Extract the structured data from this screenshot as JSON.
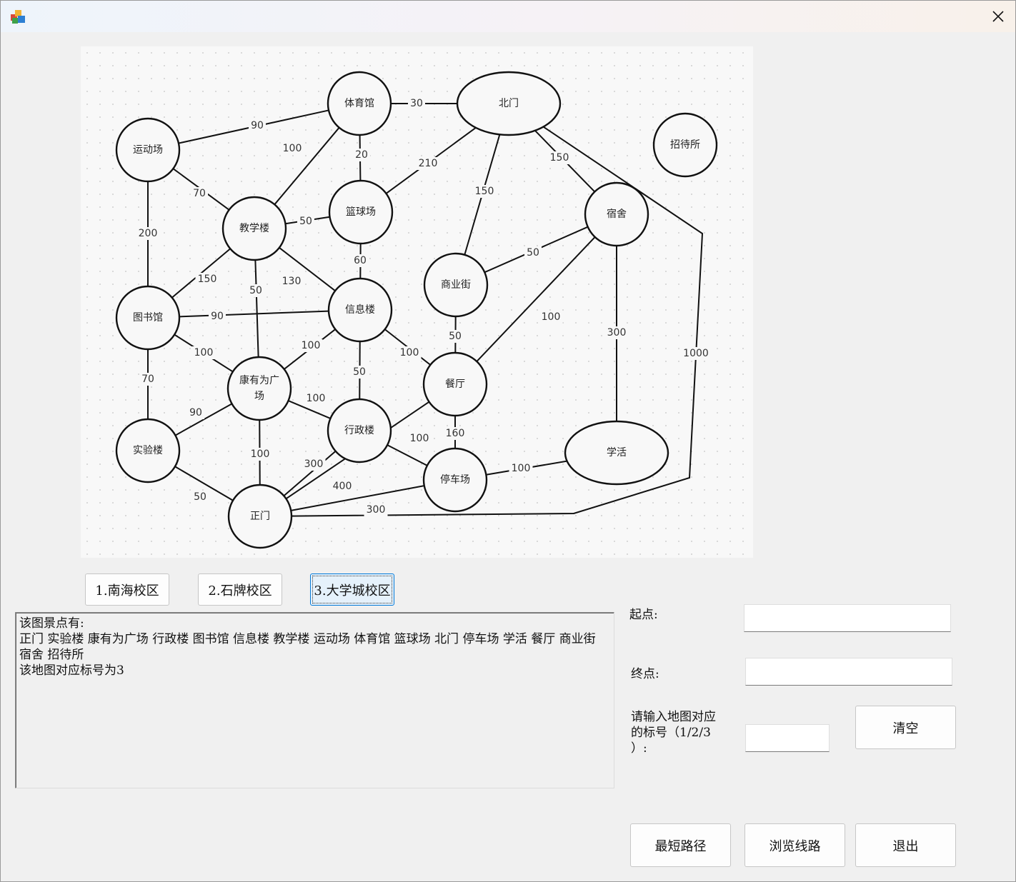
{
  "window": {
    "title": ""
  },
  "map": {
    "nodes": [
      {
        "id": "yundongchang",
        "label": "运动场",
        "shape": "circle"
      },
      {
        "id": "tiyuguan",
        "label": "体育馆",
        "shape": "circle"
      },
      {
        "id": "beimen",
        "label": "北门",
        "shape": "ellipse"
      },
      {
        "id": "zhaodaisuo",
        "label": "招待所",
        "shape": "circle"
      },
      {
        "id": "jiaoxuelou",
        "label": "教学楼",
        "shape": "circle"
      },
      {
        "id": "lanqiuchang",
        "label": "篮球场",
        "shape": "circle"
      },
      {
        "id": "sushe",
        "label": "宿舍",
        "shape": "circle"
      },
      {
        "id": "tushuguan",
        "label": "图书馆",
        "shape": "circle"
      },
      {
        "id": "xinxilou",
        "label": "信息楼",
        "shape": "circle"
      },
      {
        "id": "shangyejie",
        "label": "商业街",
        "shape": "circle"
      },
      {
        "id": "kangyouwei",
        "label": "康有为广\n场",
        "shape": "circle"
      },
      {
        "id": "canting",
        "label": "餐厅",
        "shape": "circle"
      },
      {
        "id": "shiyanlou",
        "label": "实验楼",
        "shape": "circle"
      },
      {
        "id": "xingzhenglou",
        "label": "行政楼",
        "shape": "circle"
      },
      {
        "id": "tingchechang",
        "label": "停车场",
        "shape": "circle"
      },
      {
        "id": "xuehuo",
        "label": "学活",
        "shape": "ellipse"
      },
      {
        "id": "zhengmen",
        "label": "正门",
        "shape": "circle"
      }
    ],
    "edges": [
      {
        "from": "yundongchang",
        "to": "tiyuguan",
        "weight": "90"
      },
      {
        "from": "tiyuguan",
        "to": "beimen",
        "weight": "30"
      },
      {
        "from": "tiyuguan",
        "to": "jiaoxuelou",
        "weight": "100"
      },
      {
        "from": "tiyuguan",
        "to": "lanqiuchang",
        "weight": "20"
      },
      {
        "from": "yundongchang",
        "to": "jiaoxuelou",
        "weight": "70"
      },
      {
        "from": "yundongchang",
        "to": "tushuguan",
        "weight": "200"
      },
      {
        "from": "beimen",
        "to": "lanqiuchang",
        "weight": "210"
      },
      {
        "from": "beimen",
        "to": "sushe",
        "weight": "150"
      },
      {
        "from": "beimen",
        "to": "shangyejie",
        "weight": "150"
      },
      {
        "from": "beimen",
        "to": "zhengmen",
        "weight": "1000"
      },
      {
        "from": "jiaoxuelou",
        "to": "lanqiuchang",
        "weight": "50"
      },
      {
        "from": "lanqiuchang",
        "to": "xinxilou",
        "weight": "60"
      },
      {
        "from": "jiaoxuelou",
        "to": "tushuguan",
        "weight": "150"
      },
      {
        "from": "jiaoxuelou",
        "to": "kangyouwei",
        "weight": "50"
      },
      {
        "from": "jiaoxuelou",
        "to": "xinxilou",
        "weight": "130"
      },
      {
        "from": "sushe",
        "to": "shangyejie",
        "weight": "50"
      },
      {
        "from": "sushe",
        "to": "canting",
        "weight": "100"
      },
      {
        "from": "sushe",
        "to": "xuehuo",
        "weight": "300"
      },
      {
        "from": "tushuguan",
        "to": "xinxilou",
        "weight": "90"
      },
      {
        "from": "tushuguan",
        "to": "kangyouwei",
        "weight": "100"
      },
      {
        "from": "tushuguan",
        "to": "shiyanlou",
        "weight": "70"
      },
      {
        "from": "xinxilou",
        "to": "kangyouwei",
        "weight": "100"
      },
      {
        "from": "xinxilou",
        "to": "xingzhenglou",
        "weight": "50"
      },
      {
        "from": "xinxilou",
        "to": "canting",
        "weight": "100"
      },
      {
        "from": "shangyejie",
        "to": "canting",
        "weight": "50"
      },
      {
        "from": "kangyouwei",
        "to": "shiyanlou",
        "weight": "90"
      },
      {
        "from": "kangyouwei",
        "to": "xingzhenglou",
        "weight": "100"
      },
      {
        "from": "kangyouwei",
        "to": "zhengmen",
        "weight": "100"
      },
      {
        "from": "shiyanlou",
        "to": "zhengmen",
        "weight": "50"
      },
      {
        "from": "xingzhenglou",
        "to": "tingchechang",
        "weight": "100"
      },
      {
        "from": "xingzhenglou",
        "to": "zhengmen",
        "weight": "300"
      },
      {
        "from": "canting",
        "to": "tingchechang",
        "weight": "160"
      },
      {
        "from": "canting",
        "to": "zhengmen",
        "weight": "400"
      },
      {
        "from": "tingchechang",
        "to": "xuehuo",
        "weight": "100"
      },
      {
        "from": "tingchechang",
        "to": "zhengmen",
        "weight": "300"
      }
    ]
  },
  "campus_buttons": [
    {
      "label": "1.南海校区",
      "active": false
    },
    {
      "label": "2.石牌校区",
      "active": false
    },
    {
      "label": "3.大学城校区",
      "active": true
    }
  ],
  "info_box": {
    "lines": [
      "该图景点有:",
      "正门 实验楼 康有为广场 行政楼 图书馆 信息楼 教学楼 运动场 体育馆 篮球场 北门 停车场 学活 餐厅 商业街 宿舍 招待所",
      "该地图对应标号为3"
    ]
  },
  "form": {
    "start_label": "起点:",
    "start_value": "",
    "end_label": "终点:",
    "end_value": "",
    "map_no_label_line1": "请输入地图对应",
    "map_no_label_line2": "的标号（1/2/3",
    "map_no_label_line3": "）:",
    "map_no_value": ""
  },
  "buttons": {
    "clear": "清空",
    "shortest": "最短路径",
    "browse": "浏览线路",
    "exit": "退出"
  },
  "colors": {
    "active_button_bg": "#e5f1fb",
    "active_button_border": "#0078d7"
  }
}
